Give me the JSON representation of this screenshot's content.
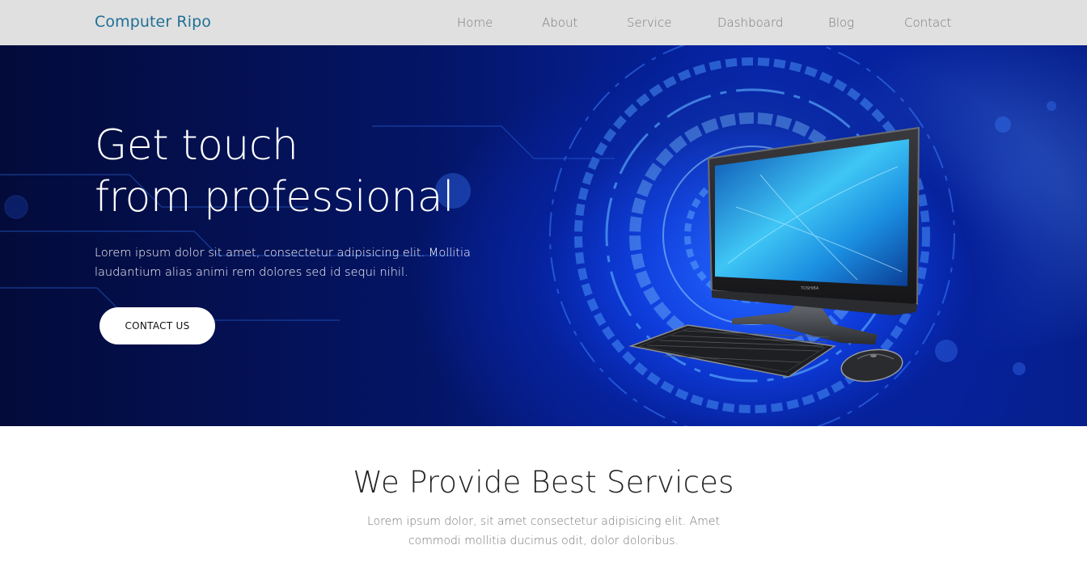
{
  "navbar": {
    "brand": "Computer Ripo",
    "links": [
      {
        "label": "Home"
      },
      {
        "label": "About"
      },
      {
        "label": "Service"
      },
      {
        "label": "Dashboard"
      },
      {
        "label": "Blog"
      },
      {
        "label": "Contact"
      }
    ],
    "brand_color": "#1f6f95",
    "background": "#e0e0e0"
  },
  "hero": {
    "title_line1": "Get touch",
    "title_line2": "from professional",
    "description": "Lorem ipsum dolor sit amet, consectetur adipisicing elit. Mollitia laudantium alias animi rem dolores sed id sequi nihil.",
    "cta_label": "CONTACT US",
    "image": "desktop-computer-with-keyboard-and-mouse",
    "monitor_brand": "TOSHIBA",
    "accent_color": "#0b36d6"
  },
  "services": {
    "title": "We Provide Best Services",
    "description": "Lorem ipsum dolor, sit amet consectetur adipisicing elit. Amet commodi mollitia ducimus odit, dolor doloribus."
  }
}
